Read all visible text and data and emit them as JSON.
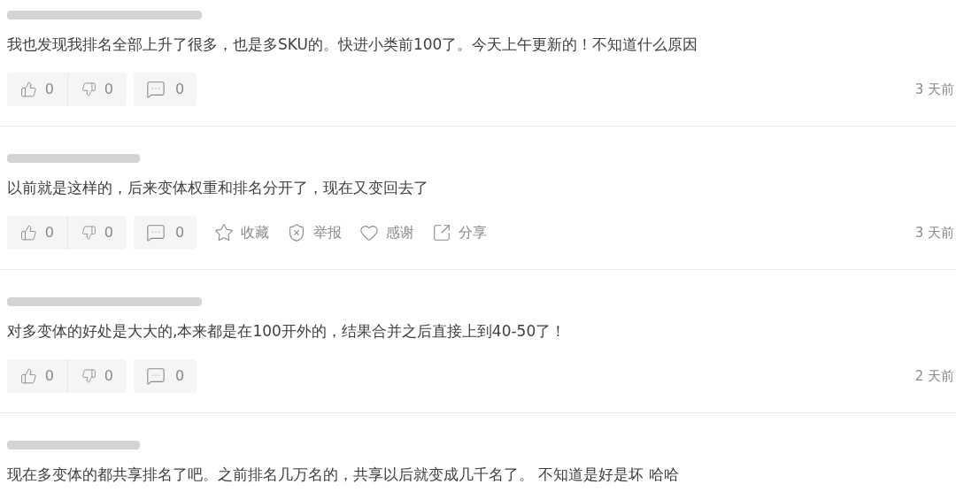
{
  "comments": [
    {
      "text": "我也发现我排名全部上升了很多，也是多SKU的。快进小类前100了。今天上午更新的！不知道什么原因",
      "likes": "0",
      "dislikes": "0",
      "replies": "0",
      "time": "3 天前"
    },
    {
      "text": "以前就是这样的，后来变体权重和排名分开了，现在又变回去了",
      "likes": "0",
      "dislikes": "0",
      "replies": "0",
      "time": "3 天前",
      "extra_actions": [
        {
          "kind": "favorite",
          "label": "收藏"
        },
        {
          "kind": "report",
          "label": "举报"
        },
        {
          "kind": "thanks",
          "label": "感谢"
        },
        {
          "kind": "share",
          "label": "分享"
        }
      ]
    },
    {
      "text": "对多变体的好处是大大的,本来都是在100开外的，结果合并之后直接上到40-50了！",
      "likes": "0",
      "dislikes": "0",
      "replies": "0",
      "time": "2 天前"
    },
    {
      "text": "现在多变体的都共享排名了吧。之前排名几万名的，共享以后就变成几千名了。 不知道是好是坏 哈哈"
    }
  ]
}
